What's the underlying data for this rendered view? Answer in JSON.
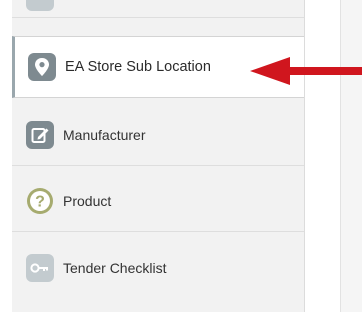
{
  "sidebar": {
    "items": [
      {
        "label": "",
        "icon": "partial-item-icon"
      },
      {
        "label": "EA Store Sub Location",
        "icon": "location-pin-icon",
        "active": true
      },
      {
        "label": "Manufacturer",
        "icon": "edit-icon"
      },
      {
        "label": "Product",
        "icon": "question-circle-icon"
      },
      {
        "label": "Tender Checklist",
        "icon": "key-icon"
      }
    ]
  },
  "annotation": {
    "arrow_color": "#d0161e"
  },
  "colors": {
    "icon_gray": "#7e8a90",
    "icon_olive": "#a6ab6f",
    "icon_light": "#c3cbcf"
  }
}
